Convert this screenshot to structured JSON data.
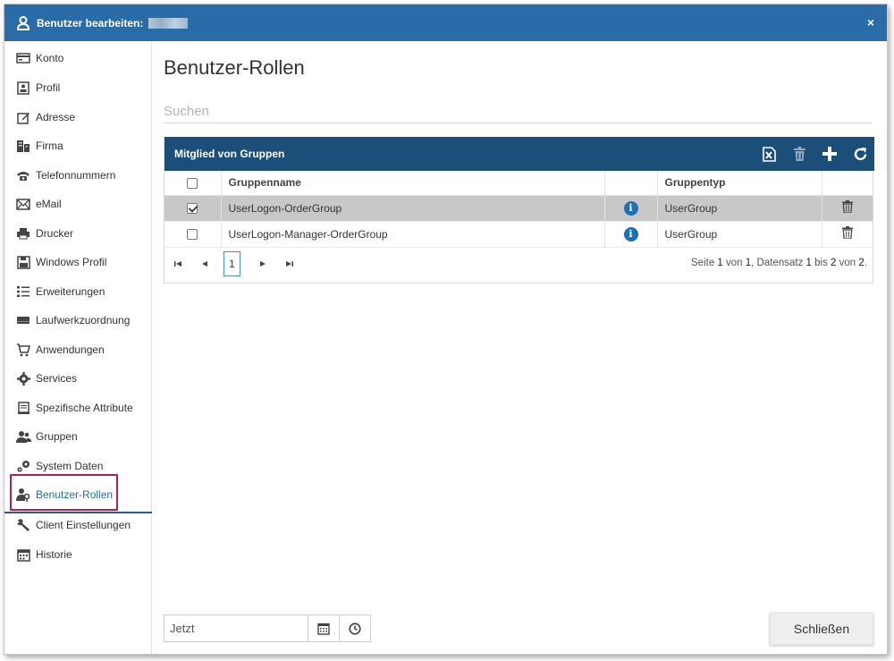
{
  "titlebar": {
    "title": "Benutzer bearbeiten:",
    "close": "×"
  },
  "sidebar": {
    "items": [
      {
        "label": "Konto",
        "icon": "card-icon"
      },
      {
        "label": "Profil",
        "icon": "id-badge-icon"
      },
      {
        "label": "Adresse",
        "icon": "edit-icon"
      },
      {
        "label": "Firma",
        "icon": "building-icon"
      },
      {
        "label": "Telefonnummern",
        "icon": "phone-icon"
      },
      {
        "label": "eMail",
        "icon": "mail-icon"
      },
      {
        "label": "Drucker",
        "icon": "printer-icon"
      },
      {
        "label": "Windows Profil",
        "icon": "floppy-icon"
      },
      {
        "label": "Erweiterungen",
        "icon": "list-icon"
      },
      {
        "label": "Laufwerkzuordnung",
        "icon": "drive-icon"
      },
      {
        "label": "Anwendungen",
        "icon": "cart-icon"
      },
      {
        "label": "Services",
        "icon": "gear-icon"
      },
      {
        "label": "Spezifische Attribute",
        "icon": "document-icon"
      },
      {
        "label": "Gruppen",
        "icon": "users-icon"
      },
      {
        "label": "System Daten",
        "icon": "cogs-icon"
      },
      {
        "label": "Benutzer-Rollen",
        "icon": "user-key-icon",
        "active": true
      },
      {
        "label": "Client Einstellungen",
        "icon": "wrench-icon"
      },
      {
        "label": "Historie",
        "icon": "calendar-icon"
      }
    ]
  },
  "main": {
    "title": "Benutzer-Rollen",
    "search_placeholder": "Suchen",
    "grid": {
      "header": "Mitglied von Gruppen",
      "columns": [
        "Gruppenname",
        "Gruppentyp"
      ],
      "rows": [
        {
          "name": "UserLogon-OrderGroup",
          "type": "UserGroup",
          "checked": true,
          "info": "i"
        },
        {
          "name": "UserLogon-Manager-OrderGroup",
          "type": "UserGroup",
          "checked": false,
          "info": "i"
        }
      ],
      "pager": {
        "page": "1",
        "info_prefix": "Seite ",
        "page_current": "1",
        "of": " von ",
        "page_total": "1",
        "records": ", Datensatz ",
        "rec_from": "1",
        "to": " bis ",
        "rec_to": "2",
        "rec_of": " von ",
        "rec_total": "2",
        "end": "."
      }
    }
  },
  "footer": {
    "date_value": "Jetzt",
    "close_label": "Schließen"
  },
  "colors": {
    "titlebar": "#2a6ca8",
    "grid_header": "#1b4f7a",
    "active": "#1f6fb2",
    "highlight": "#b0224a"
  }
}
